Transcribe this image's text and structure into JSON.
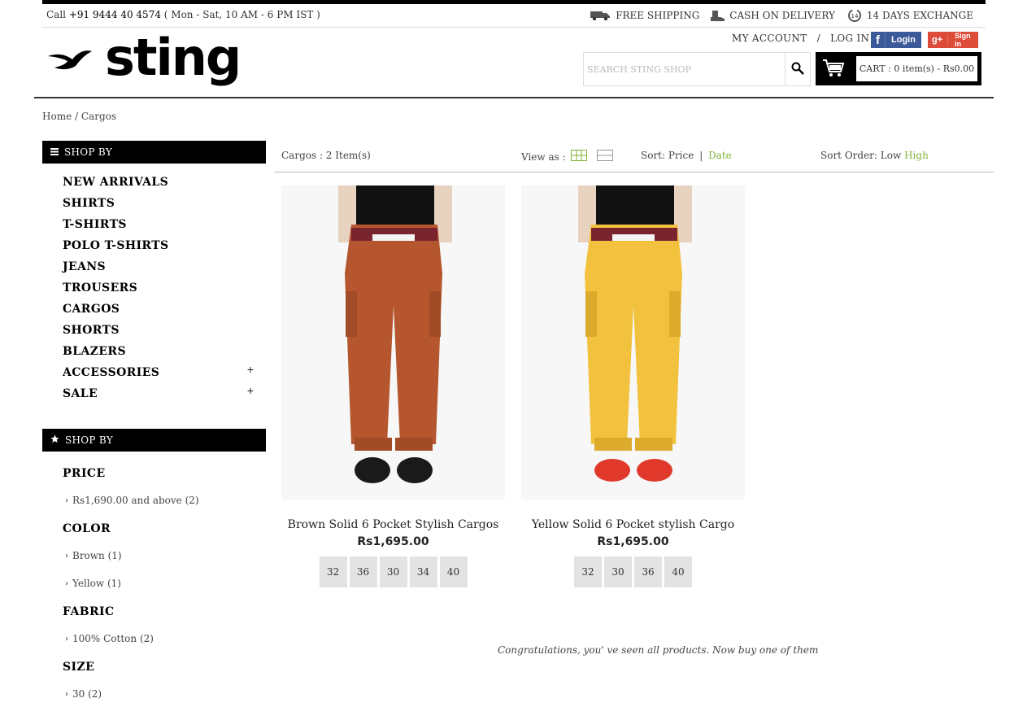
{
  "topbar": {
    "call_prefix": "Call",
    "phone": "+91 9444 40 4574",
    "hours": "( Mon - Sat, 10 AM - 6 PM IST )",
    "perks": [
      "FREE SHIPPING",
      "CASH ON DELIVERY",
      "14 DAYS EXCHANGE"
    ]
  },
  "account": {
    "my_account": "MY ACCOUNT",
    "separator": "/",
    "login": "LOG IN",
    "facebook_label": "Login",
    "google_label": "Sign in"
  },
  "brand": {
    "name": "sting"
  },
  "search": {
    "placeholder": "SEARCH STING SHOP"
  },
  "cart": {
    "label": "CART : 0 item(s) - Rs0.00"
  },
  "breadcrumb": {
    "home": "Home",
    "sep": "/",
    "current": "Cargos"
  },
  "sidebar": {
    "categories_heading": "SHOP BY",
    "categories": [
      {
        "label": "NEW ARRIVALS"
      },
      {
        "label": "SHIRTS"
      },
      {
        "label": "T-SHIRTS"
      },
      {
        "label": "POLO T-SHIRTS"
      },
      {
        "label": "JEANS"
      },
      {
        "label": "TROUSERS"
      },
      {
        "label": "CARGOS"
      },
      {
        "label": "SHORTS"
      },
      {
        "label": "BLAZERS"
      },
      {
        "label": "ACCESSORIES",
        "expand": "+"
      },
      {
        "label": "SALE",
        "expand": "+"
      }
    ],
    "filters_heading": "SHOP BY",
    "filters": {
      "price": {
        "title": "PRICE",
        "options": [
          "Rs1,690.00 and above (2)"
        ]
      },
      "color": {
        "title": "COLOR",
        "options": [
          "Brown (1)",
          "Yellow (1)"
        ]
      },
      "fabric": {
        "title": "FABRIC",
        "options": [
          "100% Cotton (2)"
        ]
      },
      "size": {
        "title": "SIZE",
        "options": [
          "30 (2)"
        ]
      }
    }
  },
  "toolbar": {
    "count": "Cargos : 2 Item(s)",
    "view_label": "View as :",
    "sort_label": "Sort:",
    "sort_price": "Price",
    "sort_sep": "|",
    "sort_date": "Date",
    "order_label": "Sort Order:",
    "order_low": "Low",
    "order_high": "High"
  },
  "products": [
    {
      "name": "Brown Solid 6 Pocket Stylish Cargos",
      "price": "Rs1,695.00",
      "sizes": [
        "32",
        "36",
        "30",
        "34",
        "40"
      ],
      "color": "#b5562e"
    },
    {
      "name": "Yellow Solid 6 Pocket stylish Cargo",
      "price": "Rs1,695.00",
      "sizes": [
        "32",
        "30",
        "36",
        "40"
      ],
      "color": "#f2c23e"
    }
  ],
  "footer_note": "Congratulations, you' ve seen all products. Now buy one of them",
  "colors": {
    "accent_green": "#7fb336",
    "header_black": "#000000"
  }
}
